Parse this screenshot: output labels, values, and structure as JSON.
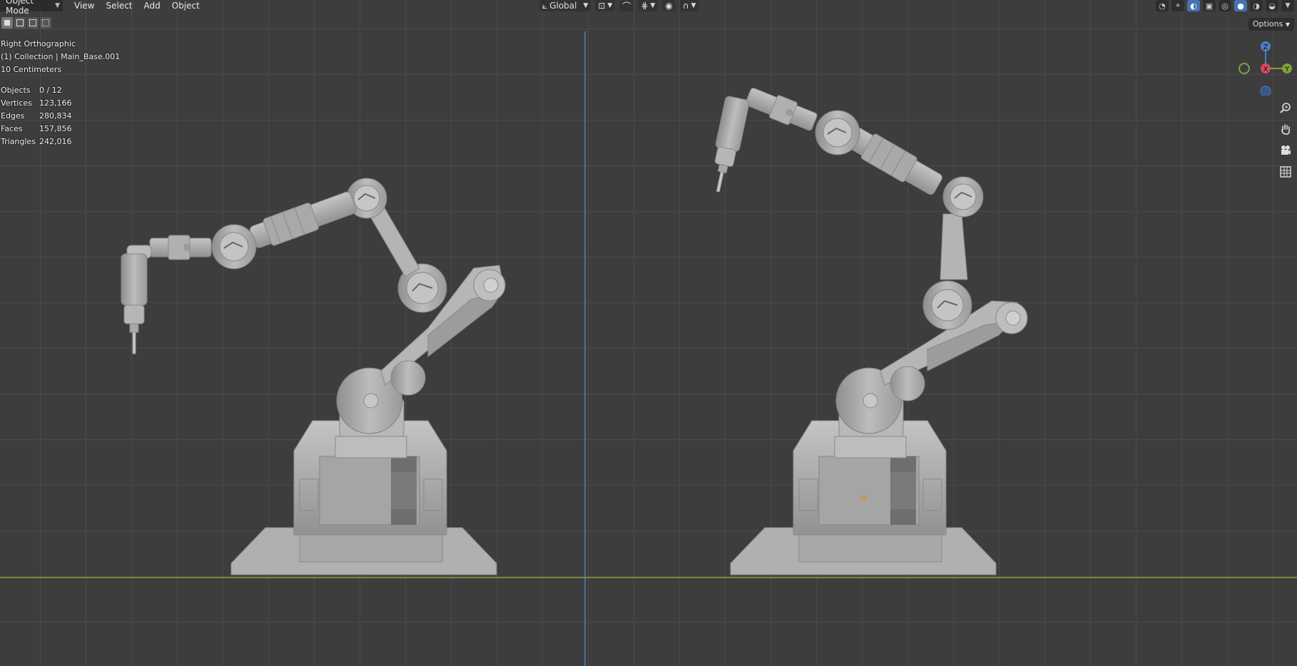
{
  "header": {
    "mode": "Object Mode",
    "menus": [
      "View",
      "Select",
      "Add",
      "Object"
    ],
    "orientation": "Global",
    "options": "Options"
  },
  "overlay": {
    "view_name": "Right Orthographic",
    "collection": "(1) Collection | Main_Base.001",
    "scale": "10 Centimeters"
  },
  "stats": [
    {
      "label": "Objects",
      "value": "0 / 12"
    },
    {
      "label": "Vertices",
      "value": "123,166"
    },
    {
      "label": "Edges",
      "value": "280,834"
    },
    {
      "label": "Faces",
      "value": "157,856"
    },
    {
      "label": "Triangles",
      "value": "242,016"
    }
  ],
  "gizmo": {
    "z": "Z",
    "x": "X",
    "y": "Y"
  },
  "colors": {
    "background": "#3d3d3d",
    "grid": "#4a4a4a",
    "x_axis": "#7da33a",
    "z_axis": "#4f7fc2",
    "mesh": "#b4b4b4",
    "accent": "#4772b3"
  },
  "icons": {
    "zoom": "zoom-icon",
    "pan": "hand-icon",
    "camera": "camera-icon",
    "grid": "grid-icon"
  }
}
